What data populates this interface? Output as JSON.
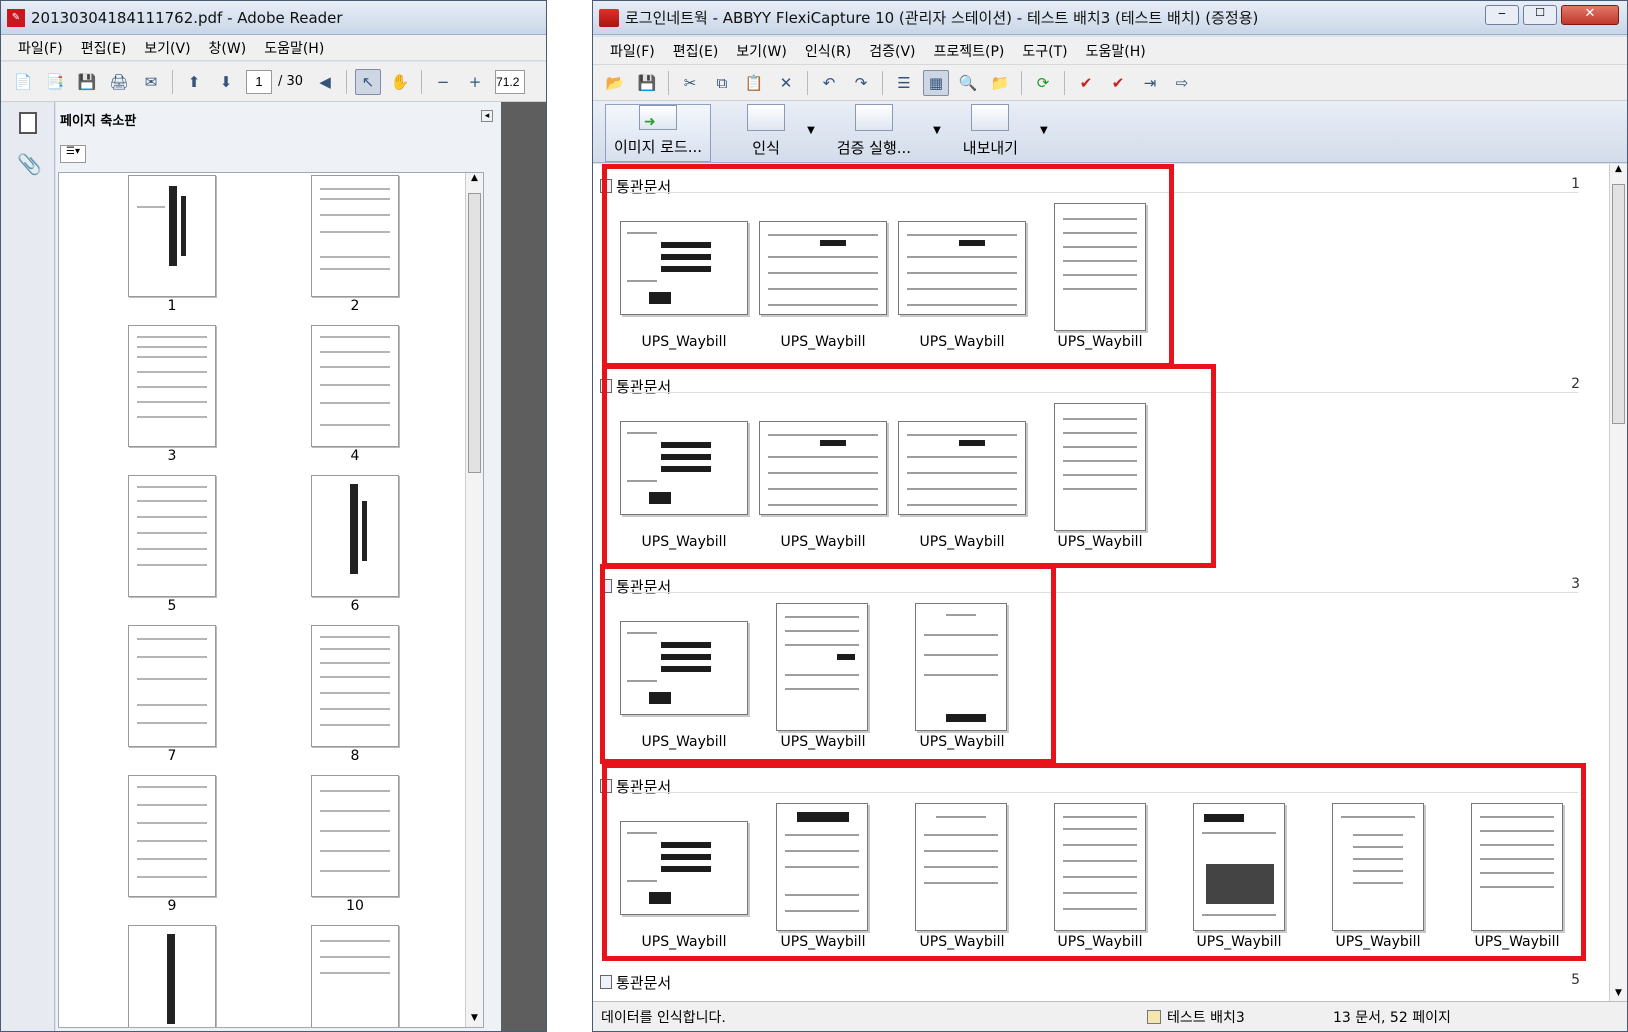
{
  "adobe": {
    "title": "20130304184111762.pdf - Adobe Reader",
    "menus": [
      "파일(F)",
      "편집(E)",
      "보기(V)",
      "창(W)",
      "도움말(H)"
    ],
    "page_input": "1",
    "page_total": "/ 30",
    "zoom": "71.2",
    "panel_title": "페이지 축소판",
    "thumb_labels": [
      "1",
      "2",
      "3",
      "4",
      "5",
      "6",
      "7",
      "8",
      "9",
      "10"
    ]
  },
  "abbyy": {
    "title": "로그인네트웍 - ABBYY FlexiCapture 10 (관리자 스테이션) - 테스트 배치3 (테스트 배치) (증정용)",
    "menus": [
      "파일(F)",
      "편집(E)",
      "보기(W)",
      "인식(R)",
      "검증(V)",
      "프로젝트(P)",
      "도구(T)",
      "도움말(H)"
    ],
    "big_buttons": [
      "이미지 로드...",
      "인식",
      "검증 실행...",
      "내보내기"
    ],
    "groups": [
      {
        "name": "통관문서",
        "num": "1",
        "cards": [
          "UPS_Waybill",
          "UPS_Waybill",
          "UPS_Waybill",
          "UPS_Waybill"
        ]
      },
      {
        "name": "통관문서",
        "num": "2",
        "cards": [
          "UPS_Waybill",
          "UPS_Waybill",
          "UPS_Waybill",
          "UPS_Waybill"
        ]
      },
      {
        "name": "통관문서",
        "num": "3",
        "cards": [
          "UPS_Waybill",
          "UPS_Waybill",
          "UPS_Waybill"
        ]
      },
      {
        "name": "통관문서",
        "num": "",
        "cards": [
          "UPS_Waybill",
          "UPS_Waybill",
          "UPS_Waybill",
          "UPS_Waybill",
          "UPS_Waybill",
          "UPS_Waybill",
          "UPS_Waybill"
        ]
      },
      {
        "name": "통관문서",
        "num": "5",
        "cards": []
      }
    ],
    "status_left": "데이터를 인식합니다.",
    "status_batch": "테스트 배치3",
    "status_count": "13 문서, 52 페이지"
  },
  "colors": {
    "highlight": "#e8121b",
    "chrome": "#dbe3ee"
  }
}
